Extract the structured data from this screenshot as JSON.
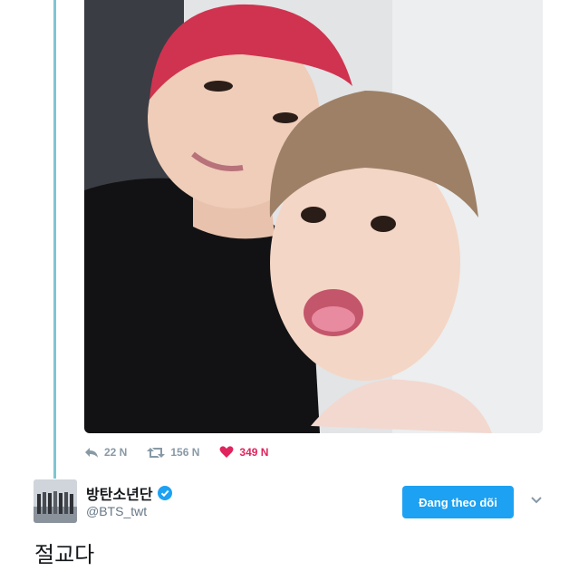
{
  "tweet_media": {
    "icon": "photo",
    "description_alt": ""
  },
  "actions": {
    "reply_count": "22 N",
    "retweet_count": "156 N",
    "like_count": "349 N",
    "reply_icon": "reply-icon",
    "retweet_icon": "retweet-icon",
    "like_icon": "heart-icon",
    "like_color": "#e0245e"
  },
  "author": {
    "display_name": "방탄소년단",
    "handle": "@BTS_twt",
    "verified": true,
    "follow_label": "Đang theo dõi",
    "follow_color": "#1da1f2"
  },
  "tweet": {
    "text": "절교다"
  }
}
